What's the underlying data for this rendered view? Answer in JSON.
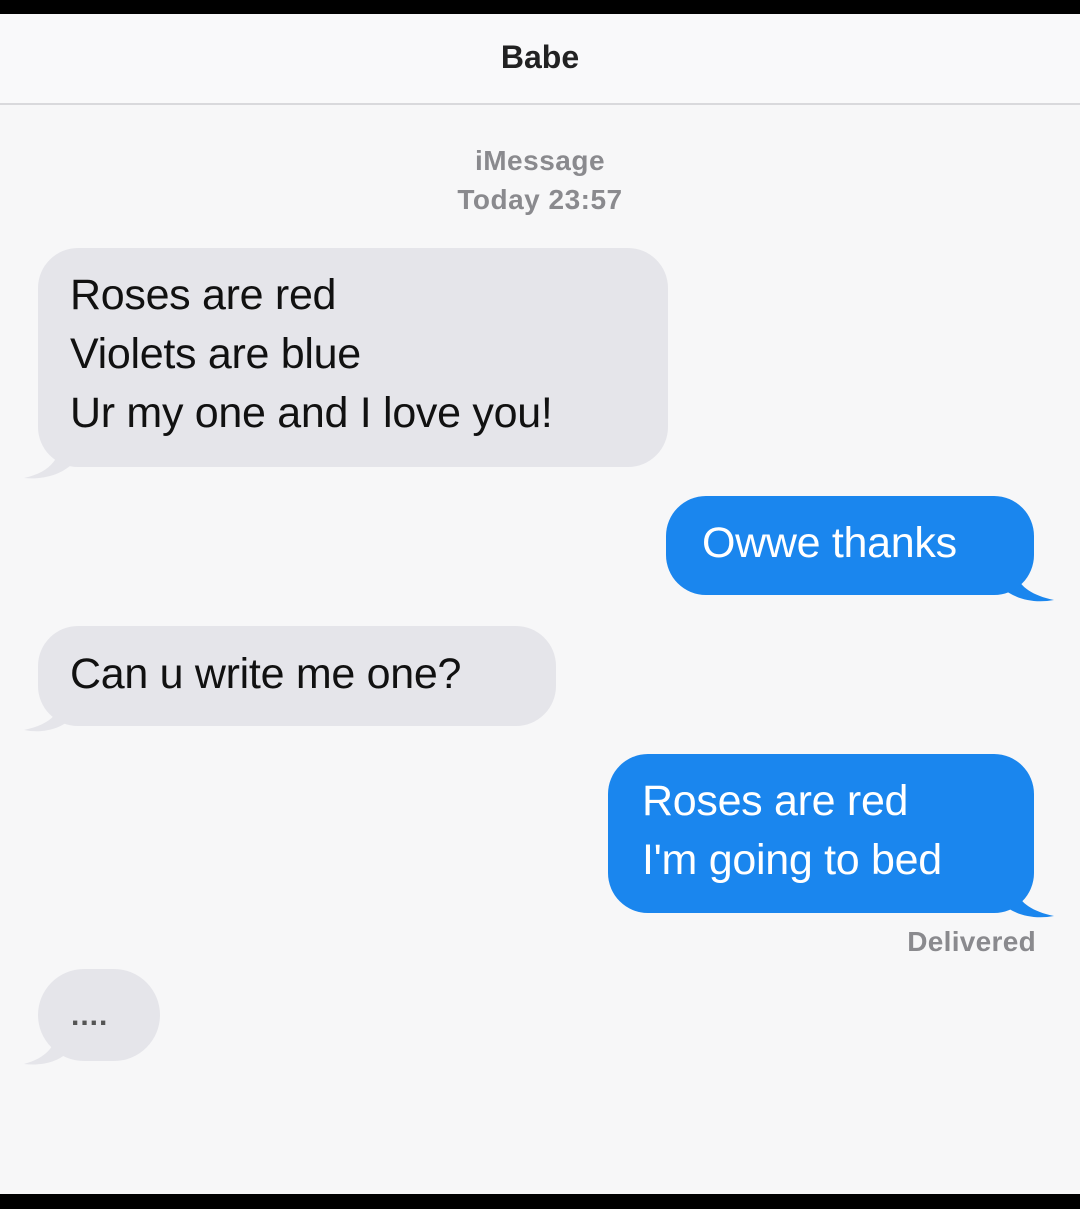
{
  "header": {
    "title": "Babe"
  },
  "thread": {
    "service": "iMessage",
    "timestamp": "Today 23:57"
  },
  "messages": [
    {
      "direction": "incoming",
      "lines": [
        "Roses are red",
        "Violets are blue",
        "Ur my one and I love you!"
      ]
    },
    {
      "direction": "outgoing",
      "lines": [
        "Owwe thanks"
      ]
    },
    {
      "direction": "incoming",
      "lines": [
        "Can u write me one?"
      ]
    },
    {
      "direction": "outgoing",
      "lines": [
        "Roses are red",
        "I'm going to bed"
      ]
    }
  ],
  "status": {
    "delivered": "Delivered"
  },
  "typing_indicator": {
    "text": "...."
  },
  "colors": {
    "incoming_bubble": "#e5e5ea",
    "outgoing_bubble": "#1a86ee",
    "meta_text": "#8a8a8e"
  }
}
